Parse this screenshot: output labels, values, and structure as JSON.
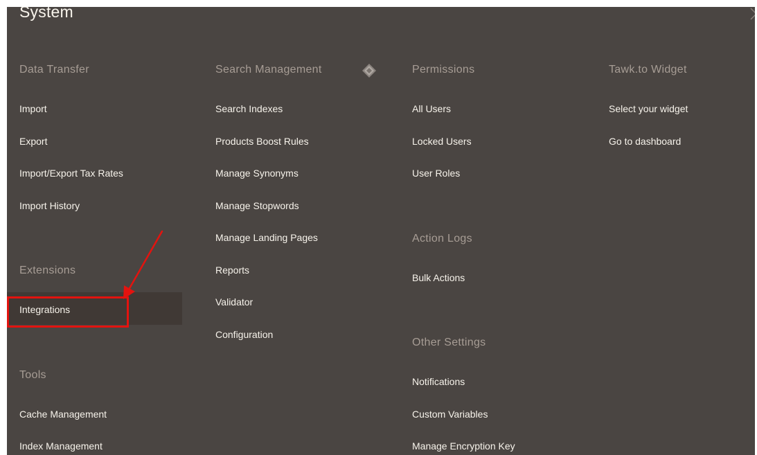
{
  "menu": {
    "title": "System",
    "close_glyph": "×",
    "columns": [
      {
        "groups": [
          {
            "heading": "Data Transfer",
            "items": [
              "Import",
              "Export",
              "Import/Export Tax Rates",
              "Import History"
            ]
          },
          {
            "heading": "Extensions",
            "items": [
              "Integrations"
            ]
          },
          {
            "heading": "Tools",
            "items": [
              "Cache Management",
              "Index Management"
            ]
          }
        ]
      },
      {
        "groups": [
          {
            "heading": "Search Management",
            "items": [
              "Search Indexes",
              "Products Boost Rules",
              "Manage Synonyms",
              "Manage Stopwords",
              "Manage Landing Pages",
              "Reports",
              "Validator",
              "Configuration"
            ]
          }
        ]
      },
      {
        "groups": [
          {
            "heading": "Permissions",
            "items": [
              "All Users",
              "Locked Users",
              "User Roles"
            ]
          },
          {
            "heading": "Action Logs",
            "items": [
              "Bulk Actions"
            ]
          },
          {
            "heading": "Other Settings",
            "items": [
              "Notifications",
              "Custom Variables",
              "Manage Encryption Key"
            ]
          }
        ]
      },
      {
        "groups": [
          {
            "heading": "Tawk.to Widget",
            "items": [
              "Select your widget",
              "Go to dashboard"
            ]
          }
        ]
      }
    ]
  },
  "icons": {
    "search_management": "diamond-logo-icon",
    "close": "close-icon"
  },
  "colors": {
    "panel_background": "#4a4542",
    "heading_text": "#a79d95",
    "link_text": "#f7f3eb",
    "active_item_background": "#403935",
    "annotation_red": "#e3130f"
  }
}
